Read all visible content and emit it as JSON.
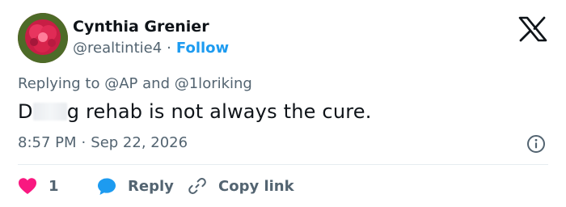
{
  "author": {
    "name": "Cynthia Grenier",
    "handle": "@realtintie4",
    "separator": "·",
    "follow_label": "Follow"
  },
  "reply_context": {
    "prefix": "Replying to",
    "mention_1": "@AP",
    "conjunction": "and",
    "mention_2": "@1loriking"
  },
  "tweet": {
    "text_start": "D",
    "text_rest": "g rehab is not always the cure."
  },
  "meta": {
    "time": "8:57 PM",
    "separator": "·",
    "date": "Sep 22, 2026"
  },
  "actions": {
    "like_count": "1",
    "reply_label": "Reply",
    "copy_link_label": "Copy link"
  },
  "colors": {
    "accent": "#1d9bf0",
    "like": "#f91880",
    "muted": "#536471",
    "text": "#0f1419"
  },
  "icons": [
    "x-logo-icon",
    "info-icon",
    "heart-icon",
    "speech-bubble-icon",
    "link-icon"
  ]
}
